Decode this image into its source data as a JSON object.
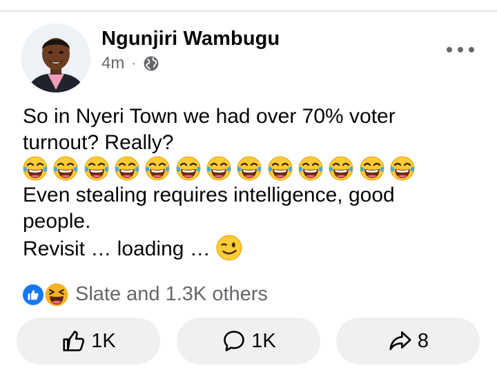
{
  "post": {
    "author": "Ngunjiri Wambugu",
    "time": "4m",
    "separator": "·",
    "privacy_icon": "globe-icon",
    "more_icon": "more-dots-icon",
    "text_lines": [
      "So in Nyeri Town we had over 70% voter",
      "turnout? Really?",
      "Even stealing requires intelligence, good",
      "people.",
      "Revisit … loading …"
    ],
    "emoji": {
      "name": "face-with-tears-of-joy",
      "count": 13
    },
    "trailing_emoji": "winking-face"
  },
  "reactions": {
    "icons": [
      "like-reaction-icon",
      "haha-reaction-icon"
    ],
    "summary": "Slate and 1.3K others"
  },
  "actions": {
    "like_count": "1K",
    "comment_count": "1K",
    "share_count": "8"
  },
  "colors": {
    "accent_blue": "#1877f2",
    "secondary_text": "#65676b",
    "button_bg": "#eef0f2",
    "emoji_yellow": "#ffcc33",
    "tear_blue": "#3fa9f5"
  }
}
